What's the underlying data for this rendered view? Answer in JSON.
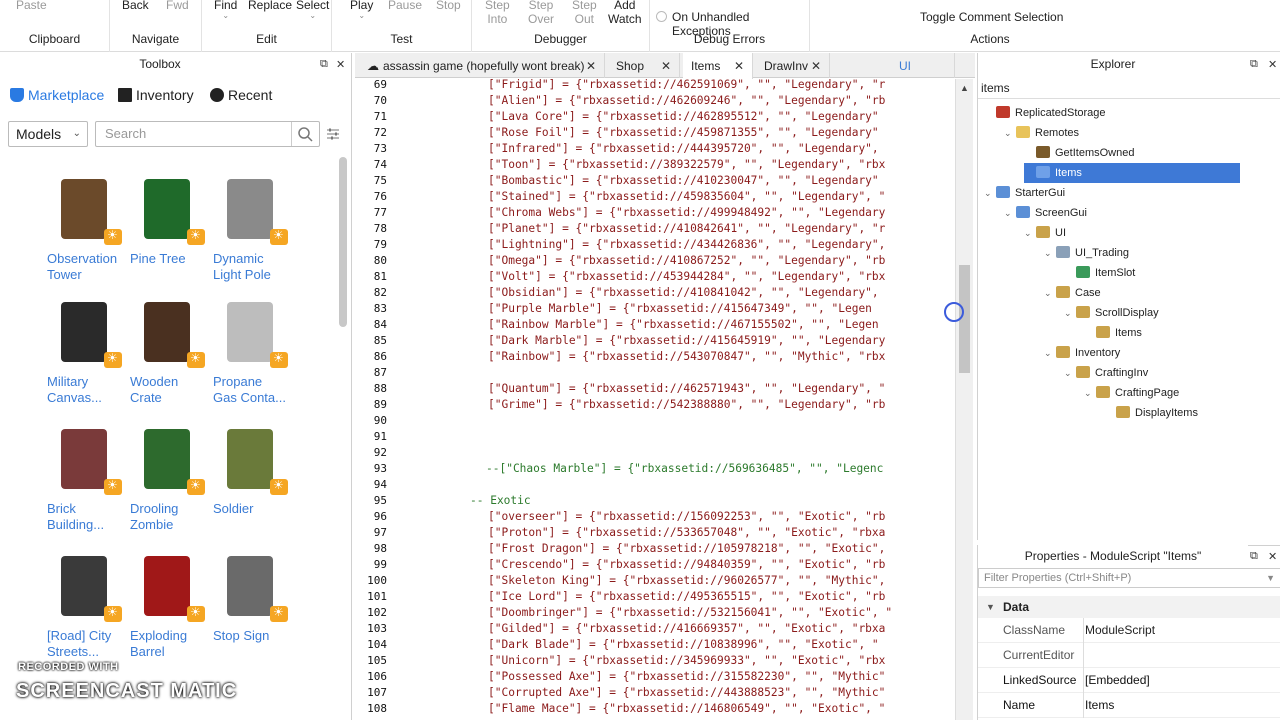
{
  "ribbon": {
    "clipboard": {
      "paste": "Paste",
      "group": "Clipboard"
    },
    "navigate": {
      "back": "Back",
      "fwd": "Fwd",
      "group": "Navigate"
    },
    "edit": {
      "find": "Find",
      "replace": "Replace",
      "select": "Select",
      "group": "Edit"
    },
    "test": {
      "play": "Play",
      "pause": "Pause",
      "stop": "Stop",
      "group": "Test"
    },
    "debugger": {
      "step_into": "Step\nInto",
      "step_over": "Step\nOver",
      "step_out": "Step\nOut",
      "add_watch": "Add\nWatch",
      "group": "Debugger"
    },
    "debug_errors": {
      "option": "On Unhandled Exceptions",
      "group": "Debug Errors"
    },
    "actions": {
      "toggle": "Toggle Comment Selection",
      "group": "Actions"
    }
  },
  "toolbox": {
    "title": "Toolbox",
    "tabs": [
      "Marketplace",
      "Inventory",
      "Recent"
    ],
    "category": "Models",
    "search_placeholder": "Search",
    "items": [
      {
        "label": "Observation\nTower",
        "color": "#6b4a2a"
      },
      {
        "label": "Pine Tree",
        "color": "#1f6a2a"
      },
      {
        "label": "Dynamic\nLight Pole",
        "color": "#8a8a8a"
      },
      {
        "label": "Military\nCanvas...",
        "color": "#2a2a2a"
      },
      {
        "label": "Wooden\nCrate",
        "color": "#4a3020"
      },
      {
        "label": "Propane\nGas Conta...",
        "color": "#bdbdbd"
      },
      {
        "label": "Brick\nBuilding...",
        "color": "#7a3a3a"
      },
      {
        "label": "Drooling\nZombie",
        "color": "#2d6a2d"
      },
      {
        "label": "Soldier",
        "color": "#6a7a3a"
      },
      {
        "label": "[Road] City\nStreets...",
        "color": "#3a3a3a"
      },
      {
        "label": "Exploding\nBarrel",
        "color": "#a01818"
      },
      {
        "label": "Stop Sign",
        "color": "#6a6a6a"
      }
    ],
    "watermark_top": "RECORDED WITH",
    "watermark_main": "SCREENCAST  MATIC"
  },
  "editor": {
    "tabs": [
      {
        "label": "assassin game (hopefully wont break)",
        "close": "✕"
      },
      {
        "label": "Shop",
        "close": "✕"
      },
      {
        "label": "Items",
        "close": "✕"
      },
      {
        "label": "DrawInv",
        "close": "✕"
      },
      {
        "label": "UI",
        "close": ""
      }
    ],
    "lines": [
      {
        "n": "69",
        "text": "[\"Frigid\"] = {\"rbxassetid://462591069\", \"\", \"Legendary\", \"r",
        "indent": 1,
        "kind": "str"
      },
      {
        "n": "70",
        "text": "[\"Alien\"] = {\"rbxassetid://462609246\", \"\", \"Legendary\", \"rb",
        "indent": 1,
        "kind": "str"
      },
      {
        "n": "71",
        "text": "[\"Lava Core\"] = {\"rbxassetid://462895512\", \"\", \"Legendary\"",
        "indent": 1,
        "kind": "str"
      },
      {
        "n": "72",
        "text": "[\"Rose Foil\"] = {\"rbxassetid://459871355\", \"\", \"Legendary\"",
        "indent": 1,
        "kind": "str"
      },
      {
        "n": "73",
        "text": "[\"Infrared\"] = {\"rbxassetid://444395720\", \"\", \"Legendary\",",
        "indent": 1,
        "kind": "str"
      },
      {
        "n": "74",
        "text": "[\"Toon\"] = {\"rbxassetid://389322579\", \"\", \"Legendary\", \"rbx",
        "indent": 1,
        "kind": "str"
      },
      {
        "n": "75",
        "text": "[\"Bombastic\"] = {\"rbxassetid://410230047\", \"\", \"Legendary\"",
        "indent": 1,
        "kind": "str"
      },
      {
        "n": "76",
        "text": "[\"Stained\"] = {\"rbxassetid://459835604\", \"\", \"Legendary\", \"",
        "indent": 1,
        "kind": "str"
      },
      {
        "n": "77",
        "text": "[\"Chroma Webs\"] = {\"rbxassetid://499948492\", \"\", \"Legendary",
        "indent": 1,
        "kind": "str"
      },
      {
        "n": "78",
        "text": "[\"Planet\"] = {\"rbxassetid://410842641\", \"\", \"Legendary\", \"r",
        "indent": 1,
        "kind": "str"
      },
      {
        "n": "79",
        "text": "[\"Lightning\"] = {\"rbxassetid://434426836\", \"\", \"Legendary\",",
        "indent": 1,
        "kind": "str"
      },
      {
        "n": "80",
        "text": "[\"Omega\"] = {\"rbxassetid://410867252\", \"\", \"Legendary\", \"rb",
        "indent": 1,
        "kind": "str"
      },
      {
        "n": "81",
        "text": "[\"Volt\"] = {\"rbxassetid://453944284\", \"\", \"Legendary\", \"rbx",
        "indent": 1,
        "kind": "str"
      },
      {
        "n": "82",
        "text": "[\"Obsidian\"] = {\"rbxassetid://410841042\", \"\", \"Legendary\", ",
        "indent": 1,
        "kind": "str"
      },
      {
        "n": "83",
        "text": "[\"Purple Marble\"] = {\"rbxassetid://415647349\", \"\", \"Legen",
        "indent": 1,
        "kind": "str"
      },
      {
        "n": "84",
        "text": "[\"Rainbow Marble\"] = {\"rbxassetid://467155502\", \"\", \"Legen",
        "indent": 1,
        "kind": "str"
      },
      {
        "n": "85",
        "text": "[\"Dark Marble\"] = {\"rbxassetid://415645919\", \"\", \"Legendary",
        "indent": 1,
        "kind": "str"
      },
      {
        "n": "86",
        "text": "[\"Rainbow\"] = {\"rbxassetid://543070847\", \"\", \"Mythic\", \"rbx",
        "indent": 1,
        "kind": "str"
      },
      {
        "n": "87",
        "text": "",
        "indent": 1,
        "kind": "str"
      },
      {
        "n": "88",
        "text": "[\"Quantum\"] = {\"rbxassetid://462571943\", \"\", \"Legendary\", \"",
        "indent": 1,
        "kind": "str"
      },
      {
        "n": "89",
        "text": "[\"Grime\"] = {\"rbxassetid://542388880\", \"\", \"Legendary\", \"rb",
        "indent": 1,
        "kind": "str"
      },
      {
        "n": "90",
        "text": "",
        "indent": 1,
        "kind": "str"
      },
      {
        "n": "91",
        "text": "",
        "indent": 1,
        "kind": "str"
      },
      {
        "n": "92",
        "text": "",
        "indent": 1,
        "kind": "str"
      },
      {
        "n": "93",
        "text": "--[\"Chaos Marble\"] = {\"rbxassetid://569636485\", \"\", \"Legenc",
        "indent": 1,
        "kind": "cm"
      },
      {
        "n": "94",
        "text": "",
        "indent": 1,
        "kind": "str"
      },
      {
        "n": "95",
        "text": "-- Exotic",
        "indent": 0,
        "kind": "cm"
      },
      {
        "n": "96",
        "text": "[\"overseer\"] = {\"rbxassetid://156092253\", \"\", \"Exotic\", \"rb",
        "indent": 1,
        "kind": "str"
      },
      {
        "n": "97",
        "text": "[\"Proton\"] = {\"rbxassetid://533657048\", \"\", \"Exotic\", \"rbxa",
        "indent": 1,
        "kind": "str"
      },
      {
        "n": "98",
        "text": "[\"Frost Dragon\"] = {\"rbxassetid://105978218\", \"\", \"Exotic\",",
        "indent": 1,
        "kind": "str"
      },
      {
        "n": "99",
        "text": "[\"Crescendo\"] = {\"rbxassetid://94840359\", \"\", \"Exotic\", \"rb",
        "indent": 1,
        "kind": "str"
      },
      {
        "n": "100",
        "text": "[\"Skeleton King\"] = {\"rbxassetid://96026577\", \"\", \"Mythic\",",
        "indent": 1,
        "kind": "str"
      },
      {
        "n": "101",
        "text": "[\"Ice Lord\"] = {\"rbxassetid://495365515\", \"\", \"Exotic\", \"rb",
        "indent": 1,
        "kind": "str"
      },
      {
        "n": "102",
        "text": "[\"Doombringer\"] = {\"rbxassetid://532156041\", \"\", \"Exotic\", \"",
        "indent": 1,
        "kind": "str"
      },
      {
        "n": "103",
        "text": "[\"Gilded\"] = {\"rbxassetid://416669357\", \"\", \"Exotic\", \"rbxa",
        "indent": 1,
        "kind": "str"
      },
      {
        "n": "104",
        "text": "[\"Dark Blade\"] = {\"rbxassetid://10838996\", \"\", \"Exotic\", \"",
        "indent": 1,
        "kind": "str"
      },
      {
        "n": "105",
        "text": "[\"Unicorn\"] = {\"rbxassetid://345969933\", \"\", \"Exotic\", \"rbx",
        "indent": 1,
        "kind": "str"
      },
      {
        "n": "106",
        "text": "[\"Possessed Axe\"] = {\"rbxassetid://315582230\", \"\", \"Mythic\"",
        "indent": 1,
        "kind": "str"
      },
      {
        "n": "107",
        "text": "[\"Corrupted Axe\"] = {\"rbxassetid://443888523\", \"\", \"Mythic\"",
        "indent": 1,
        "kind": "str"
      },
      {
        "n": "108",
        "text": "[\"Flame Mace\"] = {\"rbxassetid://146806549\", \"\", \"Exotic\", \"",
        "indent": 1,
        "kind": "str"
      }
    ]
  },
  "explorer": {
    "title": "Explorer",
    "filter": "items",
    "nodes": [
      {
        "label": "ReplicatedStorage",
        "depth": 0,
        "toggle": "",
        "icon": "#c0392b"
      },
      {
        "label": "Remotes",
        "depth": 1,
        "toggle": "⌄",
        "icon": "#e8c35a"
      },
      {
        "label": "GetItemsOwned",
        "depth": 2,
        "toggle": "",
        "icon": "#7a5a2a"
      },
      {
        "label": "Items",
        "depth": 2,
        "toggle": "",
        "icon": "#6fa0e8",
        "selected": true
      },
      {
        "label": "StarterGui",
        "depth": 0,
        "toggle": "⌄",
        "icon": "#5b8fd6"
      },
      {
        "label": "ScreenGui",
        "depth": 1,
        "toggle": "⌄",
        "icon": "#5b8fd6"
      },
      {
        "label": "UI",
        "depth": 2,
        "toggle": "⌄",
        "icon": "#c9a24a"
      },
      {
        "label": "UI_Trading",
        "depth": 3,
        "toggle": "⌄",
        "icon": "#8aa0b8"
      },
      {
        "label": "ItemSlot",
        "depth": 4,
        "toggle": "",
        "icon": "#3a9a5a"
      },
      {
        "label": "Case",
        "depth": 3,
        "toggle": "⌄",
        "icon": "#c9a24a"
      },
      {
        "label": "ScrollDisplay",
        "depth": 4,
        "toggle": "⌄",
        "icon": "#c9a24a"
      },
      {
        "label": "Items",
        "depth": 5,
        "toggle": "",
        "icon": "#c9a24a"
      },
      {
        "label": "Inventory",
        "depth": 3,
        "toggle": "⌄",
        "icon": "#c9a24a"
      },
      {
        "label": "CraftingInv",
        "depth": 4,
        "toggle": "⌄",
        "icon": "#c9a24a"
      },
      {
        "label": "CraftingPage",
        "depth": 5,
        "toggle": "⌄",
        "icon": "#c9a24a"
      },
      {
        "label": "DisplayItems",
        "depth": 6,
        "toggle": "",
        "icon": "#c9a24a"
      }
    ]
  },
  "properties": {
    "title": "Properties - ModuleScript \"Items\"",
    "filter_placeholder": "Filter Properties (Ctrl+Shift+P)",
    "section": "Data",
    "rows": [
      {
        "key": "ClassName",
        "value": "ModuleScript",
        "hl": false
      },
      {
        "key": "CurrentEditor",
        "value": "",
        "hl": false
      },
      {
        "key": "LinkedSource",
        "value": "[Embedded]",
        "hl": true
      },
      {
        "key": "Name",
        "value": "Items",
        "hl": true
      }
    ]
  }
}
